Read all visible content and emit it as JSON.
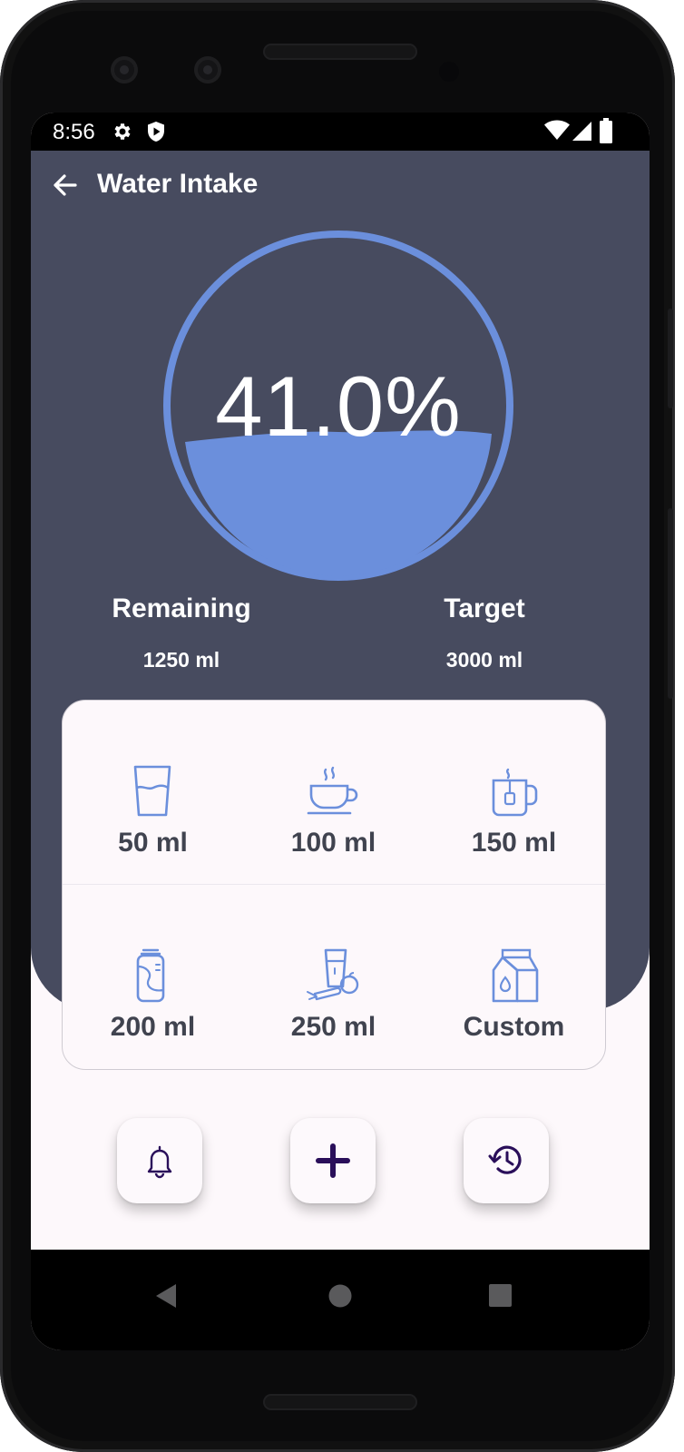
{
  "status_bar": {
    "time": "8:56",
    "icons": [
      "gear-icon",
      "shield-icon",
      "wifi-icon",
      "signal-icon",
      "battery-icon"
    ]
  },
  "app_bar": {
    "title": "Water Intake",
    "back_icon": "arrow-left-icon"
  },
  "progress": {
    "percent_text": "41.0%",
    "fill_fraction": 0.41,
    "accent_color": "#6b8fdc"
  },
  "stats": {
    "remaining_label": "Remaining",
    "remaining_value": "1250 ml",
    "target_label": "Target",
    "target_value": "3000 ml"
  },
  "presets": [
    {
      "label": "50 ml",
      "icon": "glass-icon"
    },
    {
      "label": "100 ml",
      "icon": "coffee-cup-icon"
    },
    {
      "label": "150 ml",
      "icon": "tea-mug-icon"
    },
    {
      "label": "200 ml",
      "icon": "can-icon"
    },
    {
      "label": "250 ml",
      "icon": "juice-glass-icon"
    },
    {
      "label": "Custom",
      "icon": "milk-carton-icon"
    }
  ],
  "actions": [
    {
      "icon": "bell-icon"
    },
    {
      "icon": "plus-icon"
    },
    {
      "icon": "history-icon"
    }
  ],
  "colors": {
    "header_bg": "#474b5f",
    "surface": "#fdf8fb",
    "icon_blue": "#6b8fdc",
    "icon_dark": "#2a0f5a"
  }
}
